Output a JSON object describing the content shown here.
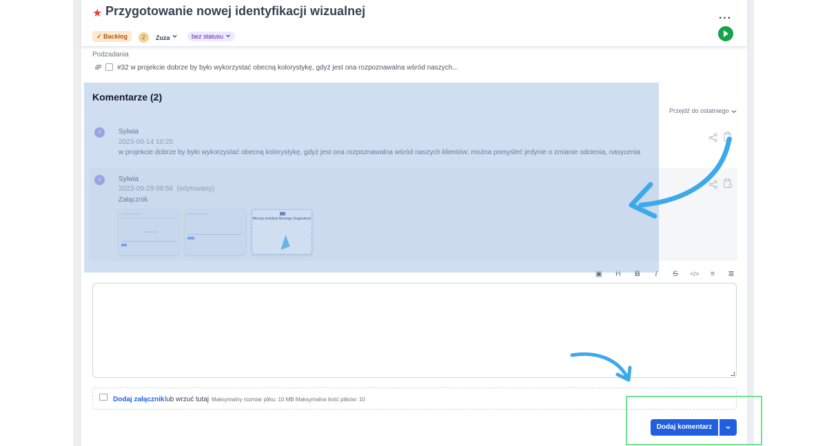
{
  "header": {
    "title": "Przygotowanie nowej identyfikacji wizualnej",
    "status_label": "✓ Backlog",
    "assignee_initial": "Z",
    "assignee": "Zuza",
    "progress_label": "bez statusu",
    "more_label": "···"
  },
  "subtasks": {
    "label": "Podzadania",
    "items": [
      {
        "text": "#32 w projekcie dobrze by było wykorzystać obecną kolorystykę, gdyż jest ona rozpoznawalna wśród naszych..."
      }
    ]
  },
  "comments": {
    "title": "Komentarze (2)",
    "jump_label": "Przejdź do ostatniego",
    "items": [
      {
        "avatar": "S",
        "author": "Sylwia",
        "date": "2023-09-14 10:25",
        "text": "w projekcie dobrze by było wykorzystać obecną kolorystykę, gdyż jest ona rozpoznawalna wśród naszych klientów; można pomyśleć jedynie o zmianie odcienia, nasycenia"
      },
      {
        "avatar": "S",
        "author": "Sylwia",
        "date": "2023-09-29 09:58  (edytowany)",
        "text": "Załącznik",
        "attachments": [
          {
            "type": "screenshot"
          },
          {
            "type": "screenshot"
          },
          {
            "type": "graphic",
            "caption": "Wersja mobilna Nowego Sugestera!"
          }
        ]
      }
    ]
  },
  "editor": {
    "toolbar": [
      "image-icon",
      "heading-icon",
      "bold-icon",
      "italic-icon",
      "strikethrough-icon",
      "code-icon",
      "bullet-list-icon",
      "numbered-list-icon"
    ],
    "toolbar_glyphs": [
      "▣",
      "H",
      "B",
      "I",
      "S",
      "</>",
      "≡",
      "≣"
    ]
  },
  "attachment": {
    "link": "Dodaj załącznik",
    "or_drop": "lub wrzuć tutaj",
    "limits": "Maksymalny rozmiar pliku: 10 MB Maksymalna ilość plików: 10"
  },
  "submit": {
    "label": "Dodaj komentarz"
  },
  "colors": {
    "primary": "#1f5fe0",
    "highlight": "#a8c2e4",
    "annotation_arrow": "#3ba9ea",
    "annotation_frame": "#6ee38f",
    "play": "#16a34a",
    "star": "#e0433a"
  }
}
